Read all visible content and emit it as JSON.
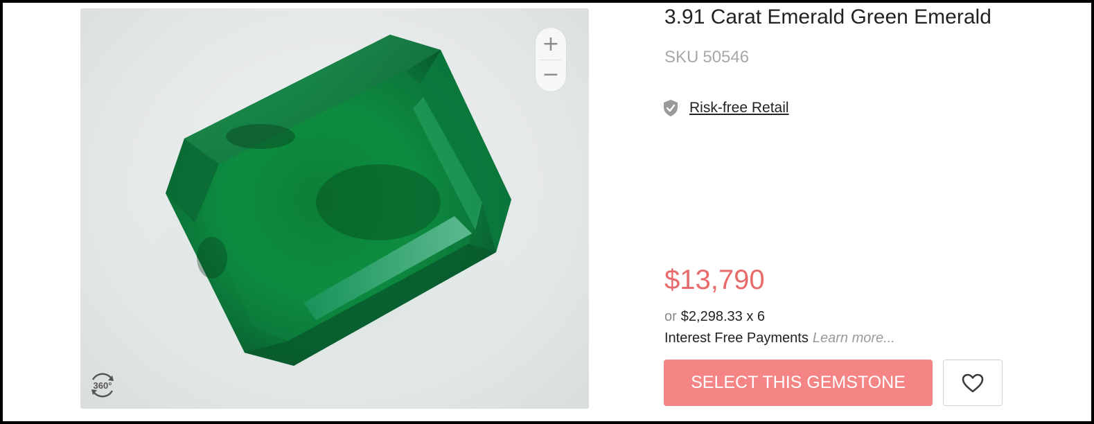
{
  "product": {
    "title": "3.91 Carat Emerald Green Emerald",
    "sku_label": "SKU",
    "sku_value": "50546"
  },
  "badge": {
    "label": "Risk-free Retail",
    "icon": "shield-check-icon"
  },
  "viewer": {
    "zoom_in_label": "+",
    "zoom_out_label": "−",
    "rotate_label": "360°"
  },
  "pricing": {
    "price": "$13,790",
    "installment_prefix": "or",
    "installment_amount": "$2,298.33 x 6",
    "interest_text": "Interest Free Payments",
    "learn_more": "Learn more..."
  },
  "actions": {
    "select_label": "SELECT THIS GEMSTONE",
    "wishlist_icon": "heart-outline-icon"
  },
  "colors": {
    "accent": "#f58484",
    "price": "#e86a6a",
    "gem": "#0b8a3e"
  }
}
